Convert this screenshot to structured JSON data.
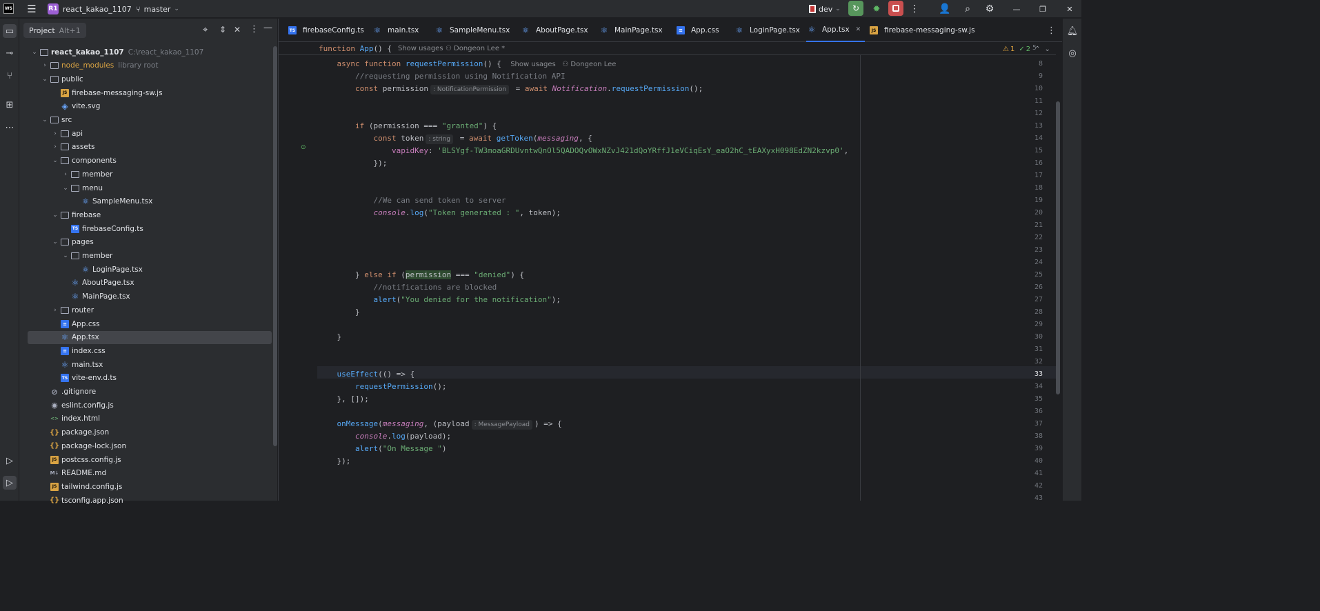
{
  "titlebar": {
    "app_logo": "WS",
    "project_badge": "R1",
    "project_name": "react_kakao_1107",
    "branch": "master",
    "run_config": "dev"
  },
  "sidebar_left_icons": [
    "folder-icon",
    "commit-icon",
    "pull-request-icon",
    "structure-icon",
    "more-icon",
    "services-icon",
    "run-icon"
  ],
  "project_panel": {
    "title": "Project",
    "shortcut": "Alt+1",
    "tree": [
      {
        "label": "react_kakao_1107",
        "hint": "C:\\react_kakao_1107",
        "indent": 0,
        "type": "folder",
        "open": true,
        "bold": true
      },
      {
        "label": "node_modules",
        "hint": "library root",
        "indent": 1,
        "type": "folder",
        "open": false
      },
      {
        "label": "public",
        "indent": 1,
        "type": "folder",
        "open": true
      },
      {
        "label": "firebase-messaging-sw.js",
        "indent": 2,
        "type": "js"
      },
      {
        "label": "vite.svg",
        "indent": 2,
        "type": "svg"
      },
      {
        "label": "src",
        "indent": 1,
        "type": "folder",
        "open": true
      },
      {
        "label": "api",
        "indent": 2,
        "type": "folder",
        "open": false
      },
      {
        "label": "assets",
        "indent": 2,
        "type": "folder",
        "open": false
      },
      {
        "label": "components",
        "indent": 2,
        "type": "folder",
        "open": true
      },
      {
        "label": "member",
        "indent": 3,
        "type": "folder",
        "open": false
      },
      {
        "label": "menu",
        "indent": 3,
        "type": "folder",
        "open": true
      },
      {
        "label": "SampleMenu.tsx",
        "indent": 4,
        "type": "react"
      },
      {
        "label": "firebase",
        "indent": 2,
        "type": "folder",
        "open": true
      },
      {
        "label": "firebaseConfig.ts",
        "indent": 3,
        "type": "ts"
      },
      {
        "label": "pages",
        "indent": 2,
        "type": "folder",
        "open": true
      },
      {
        "label": "member",
        "indent": 3,
        "type": "folder",
        "open": true
      },
      {
        "label": "LoginPage.tsx",
        "indent": 4,
        "type": "react"
      },
      {
        "label": "AboutPage.tsx",
        "indent": 3,
        "type": "react"
      },
      {
        "label": "MainPage.tsx",
        "indent": 3,
        "type": "react"
      },
      {
        "label": "router",
        "indent": 2,
        "type": "folder",
        "open": false
      },
      {
        "label": "App.css",
        "indent": 2,
        "type": "css"
      },
      {
        "label": "App.tsx",
        "indent": 2,
        "type": "react",
        "selected": true
      },
      {
        "label": "index.css",
        "indent": 2,
        "type": "css"
      },
      {
        "label": "main.tsx",
        "indent": 2,
        "type": "react"
      },
      {
        "label": "vite-env.d.ts",
        "indent": 2,
        "type": "ts"
      },
      {
        "label": ".gitignore",
        "indent": 1,
        "type": "ignore"
      },
      {
        "label": "eslint.config.js",
        "indent": 1,
        "type": "eslint"
      },
      {
        "label": "index.html",
        "indent": 1,
        "type": "html"
      },
      {
        "label": "package.json",
        "indent": 1,
        "type": "json"
      },
      {
        "label": "package-lock.json",
        "indent": 1,
        "type": "json"
      },
      {
        "label": "postcss.config.js",
        "indent": 1,
        "type": "js"
      },
      {
        "label": "README.md",
        "indent": 1,
        "type": "md"
      },
      {
        "label": "tailwind.config.js",
        "indent": 1,
        "type": "js"
      },
      {
        "label": "tsconfig.app.json",
        "indent": 1,
        "type": "json"
      }
    ]
  },
  "tabs": [
    {
      "label": "firebaseConfig.ts",
      "type": "ts"
    },
    {
      "label": "main.tsx",
      "type": "react"
    },
    {
      "label": "SampleMenu.tsx",
      "type": "react"
    },
    {
      "label": "AboutPage.tsx",
      "type": "react"
    },
    {
      "label": "MainPage.tsx",
      "type": "react"
    },
    {
      "label": "App.css",
      "type": "css"
    },
    {
      "label": "LoginPage.tsx",
      "type": "react"
    },
    {
      "label": "App.tsx",
      "type": "react",
      "active": true
    },
    {
      "label": "firebase-messaging-sw.js",
      "type": "js"
    }
  ],
  "inspections": {
    "warnings": "1",
    "weak_warnings": "2"
  },
  "editor": {
    "sticky_header": {
      "line": "5",
      "code": "function App() {",
      "show_usages": "Show usages",
      "author": "Dongeon Lee *"
    },
    "current_line": "33",
    "lines": [
      {
        "n": "8",
        "html": "    <span class=\"kw\">async function</span> <span class=\"fn\">requestPermission</span>() {  <span class=\"lens\">Show usages   ⚇ Dongeon Lee</span>"
      },
      {
        "n": "9",
        "html": "        <span class=\"cm\">//requesting permission using Notification API</span>"
      },
      {
        "n": "10",
        "html": "        <span class=\"kw\">const</span> permission<span class=\"inlay\">: NotificationPermission</span> = <span class=\"kw\">await</span> <span class=\"it\">Notification</span>.<span class=\"fn\">requestPermission</span>();"
      },
      {
        "n": "11",
        "html": ""
      },
      {
        "n": "12",
        "html": ""
      },
      {
        "n": "13",
        "html": "        <span class=\"kw\">if</span> (permission === <span class=\"str\">\"granted\"</span>) {"
      },
      {
        "n": "14",
        "html": "            <span class=\"kw\">const</span> token<span class=\"inlay\">: string</span> = <span class=\"kw\">await</span> <span class=\"fn\">getToken</span>(<span class=\"it\">messaging</span>, {"
      },
      {
        "n": "15",
        "html": "                <span class=\"fn\" style=\"color:#c77dbb\">vapidKey</span>: <span class=\"str\">'BLSYgf-TW3moaGRDUvntwQnOl5QADOQvOWxNZvJ421dQoYRffJ1eVCiqEsY_eaO2hC_tEAXyxH098EdZN2kzvp0'</span>,"
      },
      {
        "n": "16",
        "html": "            });"
      },
      {
        "n": "17",
        "html": ""
      },
      {
        "n": "18",
        "html": ""
      },
      {
        "n": "19",
        "html": "            <span class=\"cm\">//We can send token to server</span>"
      },
      {
        "n": "20",
        "html": "            <span class=\"it\">console</span>.<span class=\"fn\">log</span>(<span class=\"str\">\"Token generated : \"</span>, token);"
      },
      {
        "n": "21",
        "html": ""
      },
      {
        "n": "22",
        "html": ""
      },
      {
        "n": "23",
        "html": ""
      },
      {
        "n": "24",
        "html": ""
      },
      {
        "n": "25",
        "html": "        } <span class=\"kw\">else if</span> (<span class=\"hl\">permission</span> === <span class=\"str\">\"denied\"</span>) {"
      },
      {
        "n": "26",
        "html": "            <span class=\"cm\">//notifications are blocked</span>"
      },
      {
        "n": "27",
        "html": "            <span class=\"fn\">alert</span>(<span class=\"str\">\"You denied for the notification\"</span>);"
      },
      {
        "n": "28",
        "html": "        }"
      },
      {
        "n": "29",
        "html": ""
      },
      {
        "n": "30",
        "html": "    }"
      },
      {
        "n": "31",
        "html": ""
      },
      {
        "n": "32",
        "html": ""
      },
      {
        "n": "33",
        "html": "    <span class=\"fn\">useEffect</span>(() => {"
      },
      {
        "n": "34",
        "html": "        <span class=\"fn\">requestPermission</span>();"
      },
      {
        "n": "35",
        "html": "    }, []);"
      },
      {
        "n": "36",
        "html": ""
      },
      {
        "n": "37",
        "html": "    <span class=\"fn\">onMessage</span>(<span class=\"it\">messaging</span>, (payload<span class=\"inlay\">: MessagePayload</span>) => {"
      },
      {
        "n": "38",
        "html": "        <span class=\"it\">console</span>.<span class=\"fn\">log</span>(payload);"
      },
      {
        "n": "39",
        "html": "        <span class=\"fn\">alert</span>(<span class=\"str\">\"On Message \"</span>)"
      },
      {
        "n": "40",
        "html": "    });"
      },
      {
        "n": "41",
        "html": ""
      },
      {
        "n": "42",
        "html": ""
      },
      {
        "n": "43",
        "html": ""
      }
    ]
  }
}
